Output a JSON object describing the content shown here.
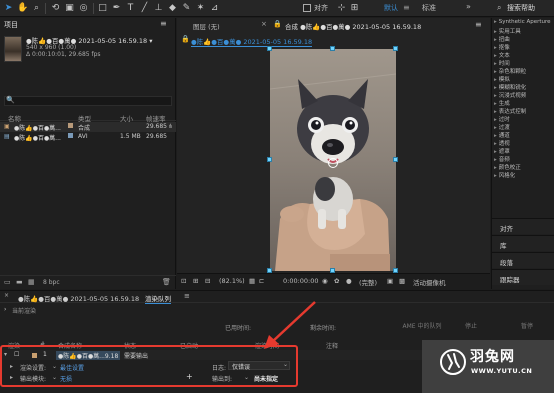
{
  "toolbar": {
    "align_label": "对齐",
    "workspace_default": "默认",
    "workspace_menu": "≡",
    "workspace_standard": "标准",
    "workspace_more": "»",
    "search_help": "搜索帮助"
  },
  "project": {
    "tab": "项目",
    "menu": "≡",
    "comp_name": "●陈👍●百●萬● 2021-05-05 16.59.18 ▾",
    "comp_size": "540 x 960 (1.00)",
    "comp_duration": "Δ 0:00:10:01, 29.685 fps",
    "search_icon": "🔍",
    "columns": {
      "name": "名称",
      "type": "类型",
      "size": "大小",
      "fps": "帧速率"
    },
    "rows": [
      {
        "name": "●陈👍●百●萬...",
        "type": "合成",
        "size": "",
        "fps": "29.685",
        "color": "#b89a7a"
      },
      {
        "name": "●陈👍●百●萬...",
        "type": "AVI",
        "size": "1.5 MB",
        "fps": "29.685",
        "color": "#7a9ab8"
      }
    ],
    "bpc": "8 bpc"
  },
  "composition": {
    "layer_tab": "图层 (无)",
    "comp_tab_close": "×",
    "comp_tab": "合成 ●陈👍●百●萬● 2021-05-05 16.59.18",
    "comp_tab_menu": "≡",
    "sub_tab": "●陈👍●百●萬● 2021-05-05 16.59.18",
    "zoom": "(82.1%)",
    "timecode": "0:00:00:00",
    "resolution": "(完整)",
    "camera": "活动摄像机"
  },
  "effects": {
    "items": [
      "Synthetic Aperture",
      "实用工具",
      "扭曲",
      "抠像",
      "文本",
      "时间",
      "杂色和颗粒",
      "模拟",
      "模糊和锐化",
      "沉浸式视频",
      "生成",
      "表达式控制",
      "过时",
      "过渡",
      "通道",
      "透视",
      "遮罩",
      "音频",
      "颜色校正",
      "风格化"
    ],
    "sections": [
      "对齐",
      "库",
      "段落",
      "跟踪器"
    ]
  },
  "render_queue": {
    "comp_tab": "●陈👍●百●萬● 2021-05-05 16.59.18",
    "tab": "渲染队列",
    "tab_menu": "≡",
    "current_render": "当前渲染",
    "elapsed": "已用时间:",
    "remaining": "剩余时间:",
    "ame_queue": "AME 中的队列",
    "stop": "停止",
    "pause": "暂停",
    "columns": {
      "render": "渲染",
      "tag": "#",
      "comp_name": "合成名称",
      "status": "状态",
      "started": "已启动",
      "render_time": "渲染时间",
      "comment": "注释"
    },
    "item": {
      "index": "1",
      "comp": "●陈👍●百●萬...9.18",
      "status": "需要输出"
    },
    "render_settings_label": "渲染设置:",
    "render_settings_value": "最佳设置",
    "output_module_label": "输出模块:",
    "output_module_value": "无损",
    "log_label": "日志:",
    "log_value": "仅错误",
    "output_to_label": "输出到:",
    "output_to_value": "尚未指定"
  },
  "watermark": {
    "title": "羽兔网",
    "url": "WWW.YUTU.CN"
  },
  "colors": {
    "accent": "#3b8fd6",
    "annotation": "#e53a2f",
    "handle": "#6fd5ff"
  }
}
